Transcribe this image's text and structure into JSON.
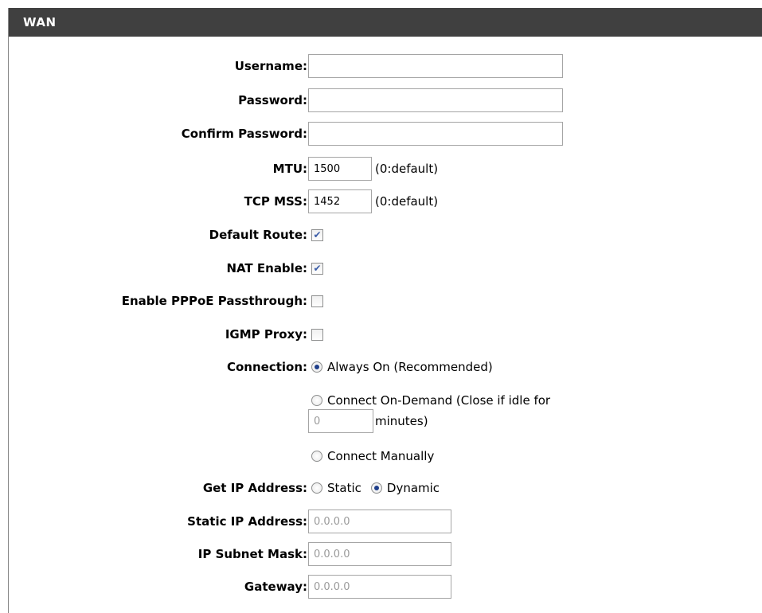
{
  "section": {
    "title": "WAN"
  },
  "fields": {
    "username": {
      "label": "Username:",
      "value": ""
    },
    "password": {
      "label": "Password:",
      "value": ""
    },
    "confirm_password": {
      "label": "Confirm Password:",
      "value": ""
    },
    "mtu": {
      "label": "MTU:",
      "value": "1500",
      "hint": "(0:default)"
    },
    "tcp_mss": {
      "label": "TCP MSS:",
      "value": "1452",
      "hint": "(0:default)"
    },
    "default_route": {
      "label": "Default Route:",
      "checked": true
    },
    "nat_enable": {
      "label": "NAT Enable:",
      "checked": true
    },
    "pppoe_passthrough": {
      "label": "Enable PPPoE Passthrough:",
      "checked": false
    },
    "igmp_proxy": {
      "label": "IGMP Proxy:",
      "checked": false
    },
    "connection": {
      "label": "Connection:",
      "options": {
        "always_on": {
          "label": "Always On (Recommended)",
          "selected": true
        },
        "on_demand": {
          "label": "Connect On-Demand (Close if idle for",
          "selected": false,
          "idle_value": "0",
          "idle_suffix": "minutes)"
        },
        "manual": {
          "label": "Connect Manually",
          "selected": false
        }
      }
    },
    "get_ip": {
      "label": "Get IP Address:",
      "options": {
        "static": {
          "label": "Static",
          "selected": false
        },
        "dynamic": {
          "label": "Dynamic",
          "selected": true
        }
      }
    },
    "static_ip": {
      "label": "Static IP Address:",
      "value": "0.0.0.0"
    },
    "subnet_mask": {
      "label": "IP Subnet Mask:",
      "value": "0.0.0.0"
    },
    "gateway": {
      "label": "Gateway:",
      "value": "0.0.0.0"
    }
  },
  "colors": {
    "header_bg": "#404040",
    "header_text": "#ffffff",
    "check_mark": "#3b5da8",
    "disabled_text": "#9a9a9a"
  }
}
